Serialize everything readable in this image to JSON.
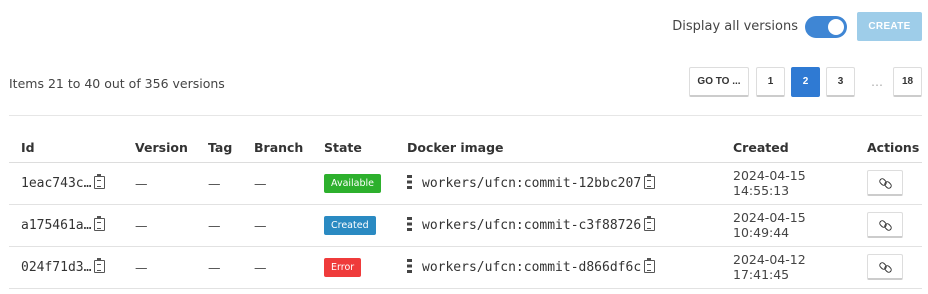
{
  "header": {
    "toggle_label": "Display all versions",
    "toggle_on": true,
    "create_label": "CREATE"
  },
  "summary": "Items 21 to 40 out of 356 versions",
  "pagination": {
    "goto_label": "GO TO ...",
    "pages": [
      "1",
      "2",
      "3"
    ],
    "current": "2",
    "ellipsis": "…",
    "last": "18"
  },
  "table": {
    "columns": [
      "Id",
      "Version",
      "Tag",
      "Branch",
      "State",
      "Docker image",
      "Created",
      "Actions"
    ],
    "rows": [
      {
        "id": "1eac743c…",
        "version": "—",
        "tag": "—",
        "branch": "—",
        "state": "Available",
        "state_color": "#2db02d",
        "docker_image": "workers/ufcn:commit-12bbc207",
        "created": "2024-04-15 14:55:13"
      },
      {
        "id": "a175461a…",
        "version": "—",
        "tag": "—",
        "branch": "—",
        "state": "Created",
        "state_color": "#2a8ac2",
        "docker_image": "workers/ufcn:commit-c3f88726",
        "created": "2024-04-15 10:49:44"
      },
      {
        "id": "024f71d3…",
        "version": "—",
        "tag": "—",
        "branch": "—",
        "state": "Error",
        "state_color": "#ef3b3b",
        "docker_image": "workers/ufcn:commit-d866df6c",
        "created": "2024-04-12 17:41:45"
      }
    ]
  },
  "colors": {
    "accent": "#2f7ad3",
    "toggle": "#3f86d4",
    "create_disabled": "#9ecde9"
  }
}
